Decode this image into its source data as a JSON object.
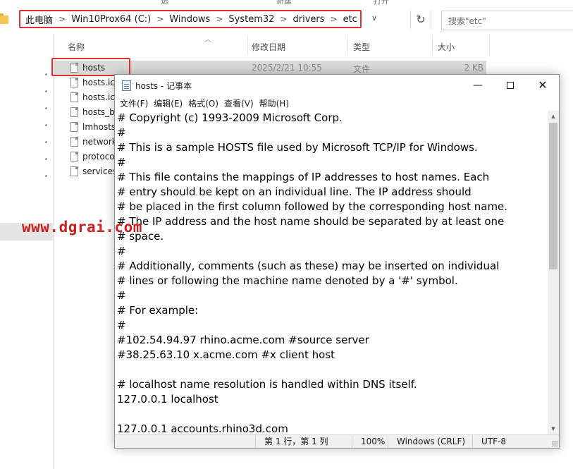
{
  "explorer": {
    "ribbon_labels": [
      "选",
      "新建",
      "打开"
    ],
    "address": {
      "crumbs": [
        "此电脑",
        "Win10Prox64 (C:)",
        "Windows",
        "System32",
        "drivers",
        "etc"
      ],
      "separator": ">",
      "dropdown_glyph": "∨",
      "refresh_glyph": "↻"
    },
    "search": {
      "placeholder": "搜索\"etc\""
    },
    "columns": [
      "名称",
      "修改日期",
      "类型",
      "大小"
    ],
    "files": [
      {
        "name": "hosts",
        "date": "2025/2/21 10:55",
        "type": "文件",
        "size": "2 KB",
        "selected": true
      },
      {
        "name": "hosts.ic",
        "date": "",
        "type": "",
        "size": "",
        "selected": false
      },
      {
        "name": "hosts.ic",
        "date": "",
        "type": "",
        "size": "",
        "selected": false
      },
      {
        "name": "hosts_b",
        "date": "",
        "type": "",
        "size": "",
        "selected": false
      },
      {
        "name": "lmhosts",
        "date": "",
        "type": "",
        "size": "",
        "selected": false
      },
      {
        "name": "network",
        "date": "",
        "type": "",
        "size": "",
        "selected": false
      },
      {
        "name": "protoco",
        "date": "",
        "type": "",
        "size": "",
        "selected": false
      },
      {
        "name": "services",
        "date": "",
        "type": "",
        "size": "",
        "selected": false
      }
    ],
    "pin_glyph": "📌"
  },
  "watermark": "www.dgrai.com",
  "notepad": {
    "title": "hosts - 记事本",
    "controls": {
      "minimize": "—",
      "close": "✕"
    },
    "menu": [
      "文件(F)",
      "编辑(E)",
      "格式(O)",
      "查看(V)",
      "帮助(H)"
    ],
    "lines": [
      "# Copyright (c) 1993-2009 Microsoft Corp.",
      "#",
      "# This is a sample HOSTS file used by Microsoft TCP/IP for Windows.",
      "#",
      "# This file contains the mappings of IP addresses to host names. Each",
      "# entry should be kept on an individual line. The IP address should",
      "# be placed in the first column followed by the corresponding host name.",
      "# The IP address and the host name should be separated by at least one",
      "# space.",
      "#",
      "# Additionally, comments (such as these) may be inserted on individual",
      "# lines or following the machine name denoted by a '#' symbol.",
      "#",
      "# For example:",
      "#",
      "#102.54.94.97 rhino.acme.com #source server",
      "#38.25.63.10 x.acme.com #x client host",
      "",
      "# localhost name resolution is handled within DNS itself.",
      "127.0.0.1 localhost",
      "",
      "127.0.0.1 accounts.rhino3d.com"
    ],
    "scroll": {
      "up_glyph": "▲",
      "down_glyph": "▼"
    },
    "status": {
      "position": "第 1 行，第 1 列",
      "zoom": "100%",
      "line_ending": "Windows (CRLF)",
      "encoding": "UTF-8"
    }
  }
}
